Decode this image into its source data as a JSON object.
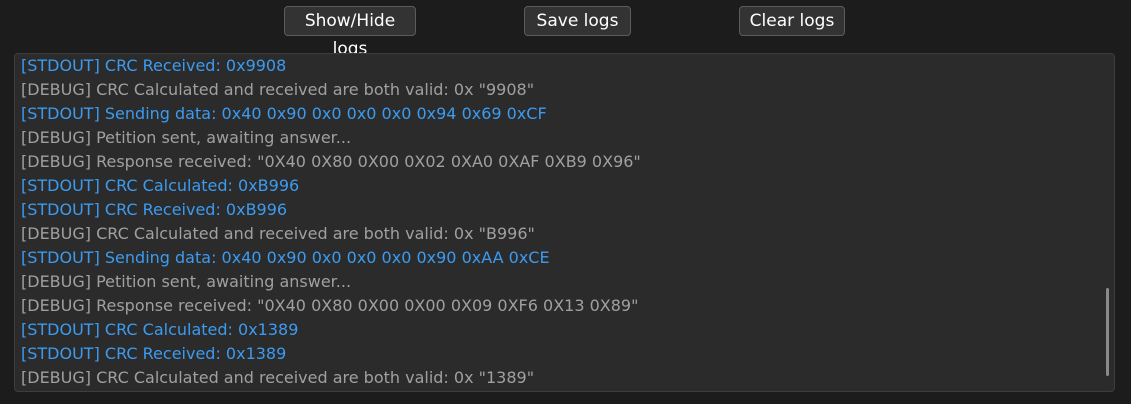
{
  "toolbar": {
    "show_hide_label": "Show/Hide logs",
    "save_label": "Save logs",
    "clear_label": "Clear logs"
  },
  "colors": {
    "stdout": "#3c9bf0",
    "debug": "#a0a0a0",
    "background": "#1c1c1c",
    "panel": "#2b2b2b"
  },
  "logs": [
    {
      "level": "stdout",
      "text": "[STDOUT] CRC Received: 0x9908"
    },
    {
      "level": "debug",
      "text": "[DEBUG] CRC Calculated and received are both valid: 0x \"9908\""
    },
    {
      "level": "stdout",
      "text": "[STDOUT] Sending data: 0x40 0x90 0x0 0x0 0x0 0x94 0x69 0xCF"
    },
    {
      "level": "debug",
      "text": "[DEBUG] Petition sent, awaiting answer..."
    },
    {
      "level": "debug",
      "text": "[DEBUG] Response received: \"0X40 0X80 0X00 0X02 0XA0 0XAF 0XB9 0X96\""
    },
    {
      "level": "stdout",
      "text": "[STDOUT] CRC Calculated: 0xB996"
    },
    {
      "level": "stdout",
      "text": "[STDOUT] CRC Received: 0xB996"
    },
    {
      "level": "debug",
      "text": "[DEBUG] CRC Calculated and received are both valid: 0x \"B996\""
    },
    {
      "level": "stdout",
      "text": "[STDOUT] Sending data: 0x40 0x90 0x0 0x0 0x0 0x90 0xAA 0xCE"
    },
    {
      "level": "debug",
      "text": "[DEBUG] Petition sent, awaiting answer..."
    },
    {
      "level": "debug",
      "text": "[DEBUG] Response received: \"0X40 0X80 0X00 0X00 0X09 0XF6 0X13 0X89\""
    },
    {
      "level": "stdout",
      "text": "[STDOUT] CRC Calculated: 0x1389"
    },
    {
      "level": "stdout",
      "text": "[STDOUT] CRC Received: 0x1389"
    },
    {
      "level": "debug",
      "text": "[DEBUG] CRC Calculated and received are both valid: 0x \"1389\""
    }
  ]
}
